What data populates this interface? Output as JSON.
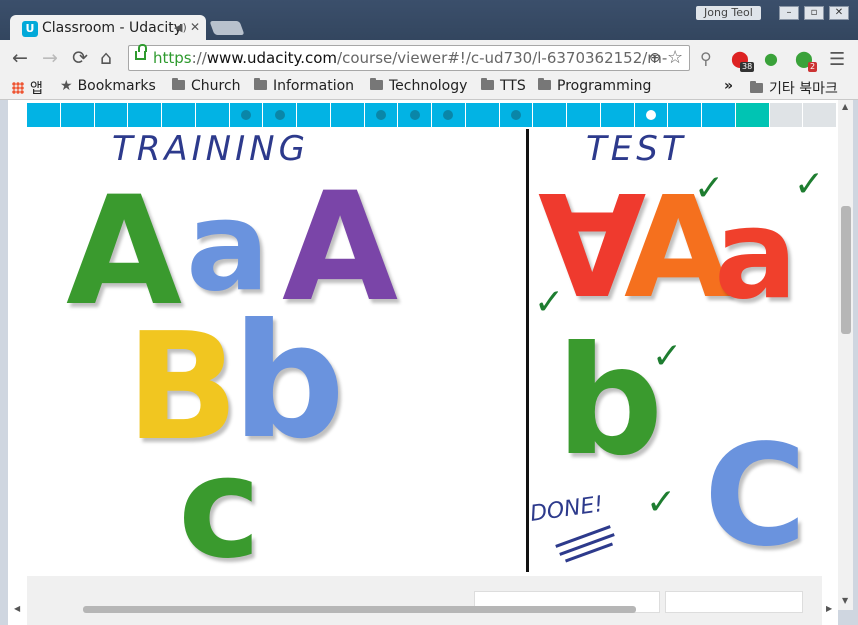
{
  "browser": {
    "user_name": "Jong Teol",
    "tab_title": "Classroom - Udacity",
    "url_scheme": "https",
    "url_sep": "://",
    "url_host": "www.udacity.com",
    "url_path": "/course/viewer#!/c-ud730/l-6370362152/m-",
    "nav": {
      "back": "←",
      "forward": "→",
      "reload": "⟳",
      "home": "⌂"
    },
    "extensions": [
      {
        "icon": "magnifier-icon",
        "badge": ""
      },
      {
        "icon": "extension-red-icon",
        "badge": "38"
      },
      {
        "icon": "extension-green-icon",
        "badge": ""
      },
      {
        "icon": "extension-green-d-icon",
        "badge": "2"
      }
    ]
  },
  "bookmarks": {
    "apps_label": "앱",
    "items": [
      "Bookmarks",
      "Church",
      "Information",
      "Technology",
      "TTS",
      "Programming"
    ],
    "more": "»",
    "other_label": "기타 북마크"
  },
  "lesson": {
    "progress_segments": 24,
    "dot_segments": [
      6,
      7,
      10,
      11,
      12,
      14,
      18
    ],
    "current_segment": 18,
    "training_label": "TRAINING",
    "test_label": "TEST",
    "done_label": "DONE!",
    "training_letters": [
      {
        "char": "A",
        "color": "#3a9a2e"
      },
      {
        "char": "a",
        "color": "#6a93de"
      },
      {
        "char": "A",
        "color": "#7a45a8"
      },
      {
        "char": "B",
        "color": "#f1c620"
      },
      {
        "char": "b",
        "color": "#6a93de"
      },
      {
        "char": "c",
        "color": "#3a9a2e"
      }
    ],
    "test_letters": [
      {
        "char": "∀",
        "color": "#ef3a2e"
      },
      {
        "char": "A",
        "color": "#f5701e"
      },
      {
        "char": "a",
        "color": "#f0402c"
      },
      {
        "char": "b",
        "color": "#3a9a2e"
      },
      {
        "char": "C",
        "color": "#6a93de"
      }
    ],
    "check_mark": "✓"
  },
  "colors": {
    "accent": "#02b3e4",
    "teal": "#00c4b3",
    "ink": "#2d3a8c",
    "check": "#1e7d30"
  }
}
